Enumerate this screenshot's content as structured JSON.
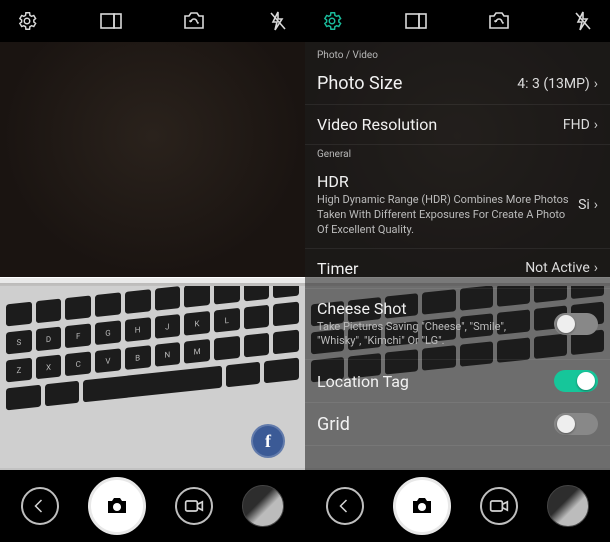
{
  "top_icons": [
    "settings-icon",
    "aspect-icon",
    "switch-camera-icon",
    "flash-off-icon"
  ],
  "bottom_icons": [
    "back-icon",
    "camera-icon",
    "video-icon",
    "gallery-thumb"
  ],
  "left": {
    "fb_label": "f"
  },
  "right": {
    "sections": {
      "photo_video_header": "Photo / Video",
      "general_header": "General"
    },
    "photo_size": {
      "title": "Photo Size",
      "value": "4: 3 (13MP)"
    },
    "video_res": {
      "title": "Video Resolution",
      "value": "FHD"
    },
    "hdr": {
      "title": "HDR",
      "sub": "High Dynamic Range (HDR) Combines More Photos Taken With Different Exposures For Create A Photo Of Excellent Quality.",
      "value": "Si"
    },
    "timer": {
      "title": "Timer",
      "value": "Not Active"
    },
    "cheese": {
      "title": "Cheese Shot",
      "sub": "Take Pictures Saving \"Cheese\", \"Smile\", \"Whisky\", \"Kimchi\" Or \"LG\".",
      "toggle": false
    },
    "location": {
      "title": "Location Tag",
      "toggle": true
    },
    "grid": {
      "title": "Grid",
      "toggle": false
    }
  }
}
